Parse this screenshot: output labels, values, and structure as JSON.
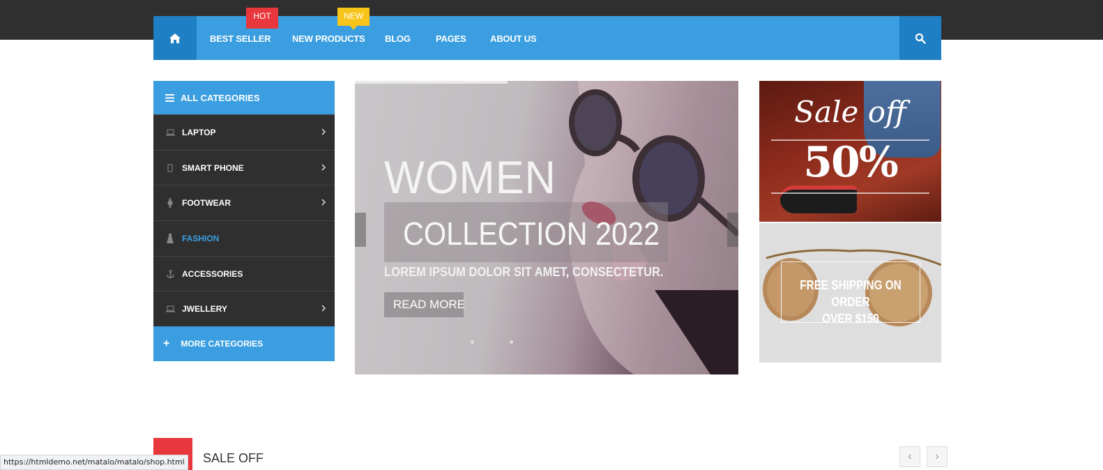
{
  "nav": {
    "items": [
      {
        "label": "BEST SELLER"
      },
      {
        "label": "NEW PRODUCTS"
      },
      {
        "label": "BLOG"
      },
      {
        "label": "PAGES"
      },
      {
        "label": "ABOUT US"
      }
    ],
    "badges": {
      "hot": "HOT",
      "new": "NEW"
    },
    "home_icon": "home-icon",
    "search_icon": "search-icon"
  },
  "categories": {
    "header": "ALL CATEGORIES",
    "items": [
      {
        "label": "LAPTOP",
        "icon": "laptop-icon",
        "has_submenu": true
      },
      {
        "label": "SMART PHONE",
        "icon": "phone-icon",
        "has_submenu": true
      },
      {
        "label": "FOOTWEAR",
        "icon": "watch-icon",
        "has_submenu": true
      },
      {
        "label": "FASHION",
        "icon": "dress-icon",
        "has_submenu": false,
        "active": true
      },
      {
        "label": "ACCESSORIES",
        "icon": "anchor-icon",
        "has_submenu": false
      },
      {
        "label": "JWELLERY",
        "icon": "laptop-icon",
        "has_submenu": true
      }
    ],
    "more": "MORE CATEGORIES"
  },
  "slider": {
    "title": "WOMEN",
    "subtitle": "COLLECTION 2022",
    "text": "LOREM IPSUM DOLOR SIT AMET, CONSECTETUR.",
    "button": "READ MORE"
  },
  "promo": {
    "sale_text": "Sale off",
    "sale_pct": "50%",
    "shipping_line1": "FREE SHIPPING ON ORDER",
    "shipping_line2": "OVER $150"
  },
  "section": {
    "title": "SALE OFF"
  },
  "status_url": "https://htmldemo.net/matalo/matalo/shop.html",
  "colors": {
    "accent": "#3a9ee0",
    "accent_dark": "#1f7fc4",
    "dark": "#2f2f2f",
    "hot": "#e8383d",
    "new": "#f7c51a"
  }
}
